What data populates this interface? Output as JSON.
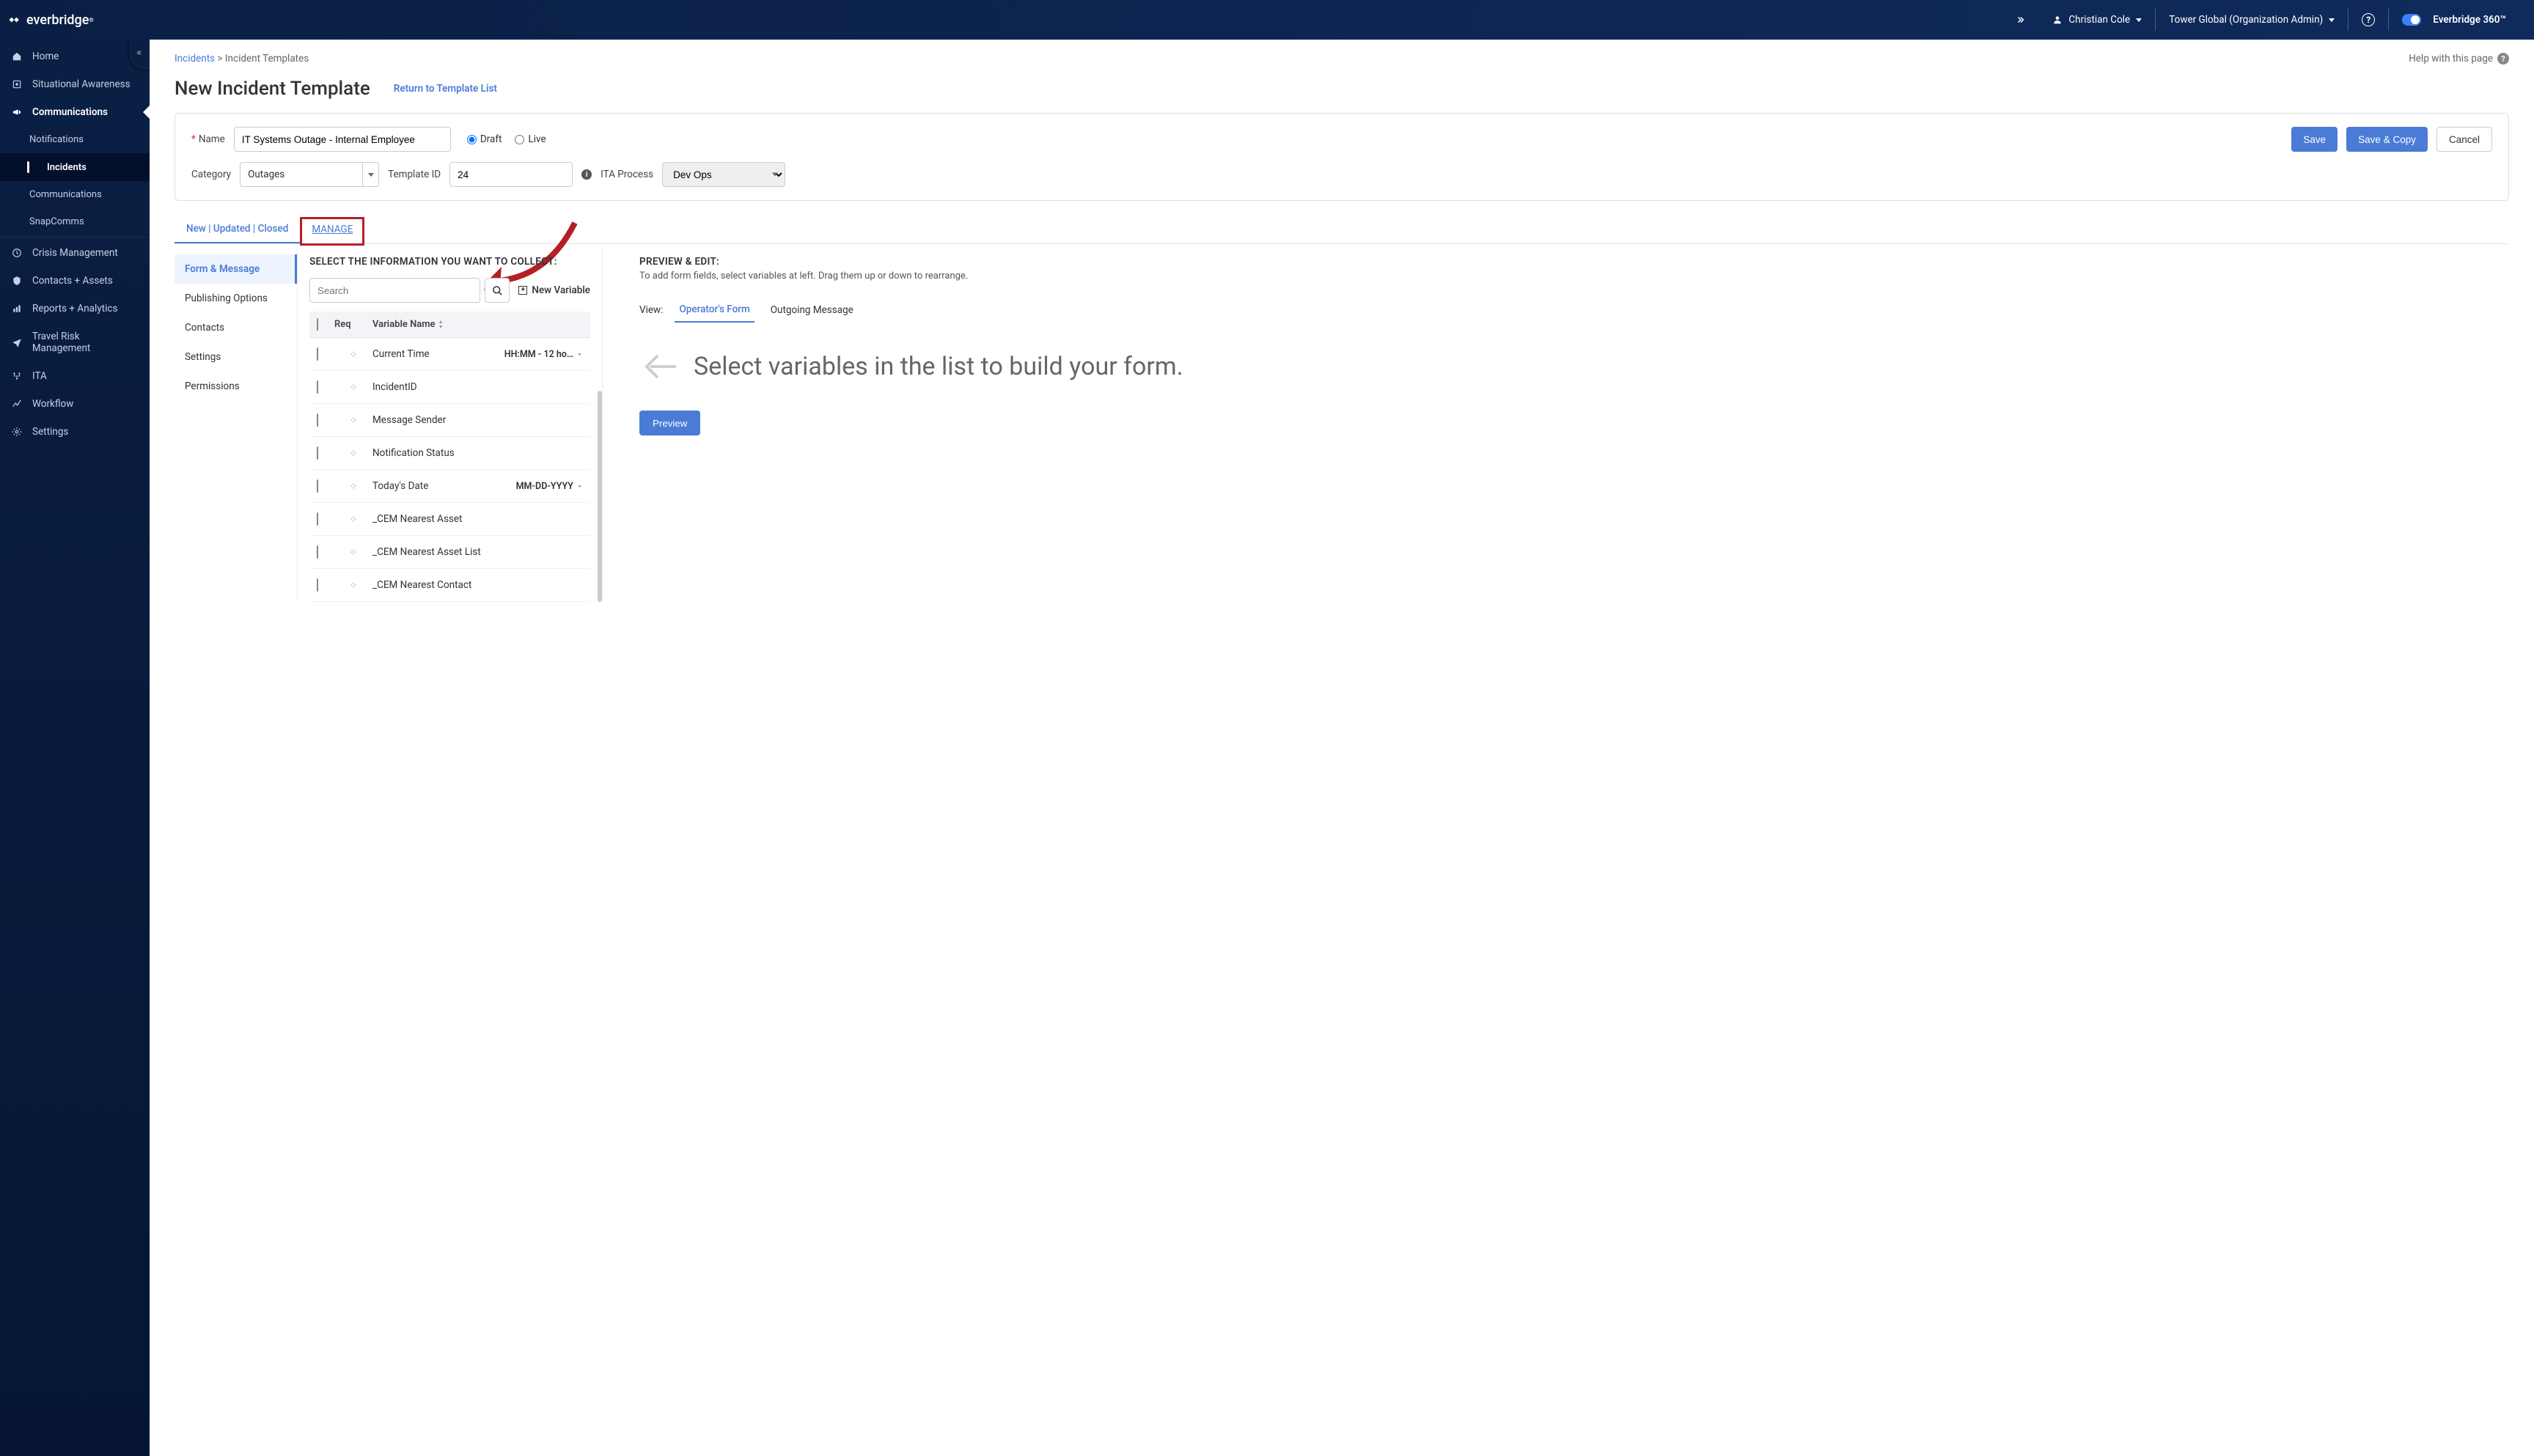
{
  "header": {
    "brand": "everbridge",
    "user_name": "Christian Cole",
    "org_label": "Tower Global (Organization Admin)",
    "product_label": "Everbridge 360™"
  },
  "breadcrumb": {
    "root": "Incidents",
    "sep": ">",
    "current": "Incident Templates",
    "help_text": "Help with this page"
  },
  "sidebar": {
    "items": [
      {
        "label": "Home"
      },
      {
        "label": "Situational Awareness"
      },
      {
        "label": "Communications"
      },
      {
        "label": "Notifications"
      },
      {
        "label": "Incidents"
      },
      {
        "label": "Communications"
      },
      {
        "label": "SnapComms"
      },
      {
        "label": "Crisis Management"
      },
      {
        "label": "Contacts + Assets"
      },
      {
        "label": "Reports + Analytics"
      },
      {
        "label": "Travel Risk Management"
      },
      {
        "label": "ITA"
      },
      {
        "label": "Workflow"
      },
      {
        "label": "Settings"
      }
    ]
  },
  "page": {
    "title": "New Incident Template",
    "return_link": "Return to Template List"
  },
  "form": {
    "name_label": "Name",
    "name_value": "IT Systems Outage - Internal Employee",
    "draft_label": "Draft",
    "live_label": "Live",
    "save_label": "Save",
    "save_copy_label": "Save & Copy",
    "cancel_label": "Cancel",
    "category_label": "Category",
    "category_value": "Outages",
    "template_id_label": "Template ID",
    "template_id_value": "24",
    "ita_process_label": "ITA Process",
    "ita_process_value": "Dev Ops"
  },
  "tabs": {
    "main": "New | Updated | Closed",
    "manage": "MANAGE"
  },
  "rail": {
    "items": [
      {
        "label": "Form & Message"
      },
      {
        "label": "Publishing Options"
      },
      {
        "label": "Contacts"
      },
      {
        "label": "Settings"
      },
      {
        "label": "Permissions"
      }
    ]
  },
  "center": {
    "title": "SELECT THE INFORMATION YOU WANT TO COLLECT:",
    "search_placeholder": "Search",
    "new_variable": "New Variable",
    "col_req": "Req",
    "col_name": "Variable Name",
    "vars": [
      {
        "name": "Current Time",
        "format": "HH:MM - 12 ho…"
      },
      {
        "name": "IncidentID",
        "format": ""
      },
      {
        "name": "Message Sender",
        "format": ""
      },
      {
        "name": "Notification Status",
        "format": ""
      },
      {
        "name": "Today's Date",
        "format": "MM-DD-YYYY"
      },
      {
        "name": "_CEM Nearest Asset",
        "format": ""
      },
      {
        "name": "_CEM Nearest Asset List",
        "format": ""
      },
      {
        "name": "_CEM Nearest Contact",
        "format": ""
      }
    ]
  },
  "right": {
    "title": "PREVIEW & EDIT:",
    "subtitle": "To add form fields, select variables at left. Drag them up or down to rearrange.",
    "view_label": "View:",
    "view_tab1": "Operator's Form",
    "view_tab2": "Outgoing Message",
    "hint": "Select variables in the list to build your form.",
    "preview_btn": "Preview"
  }
}
